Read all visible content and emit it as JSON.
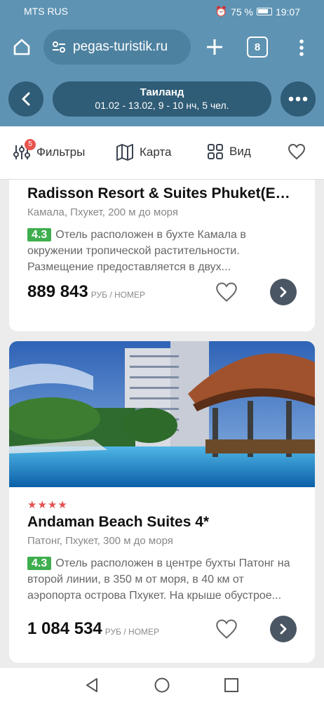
{
  "status": {
    "carrier": "MTS RUS",
    "battery": "75 %",
    "time": "19:07"
  },
  "browser": {
    "url": "pegas-turistik.ru",
    "tab_count": "8"
  },
  "search": {
    "destination": "Таиланд",
    "params": "01.02 - 13.02, 9 - 10 нч, 5 чел."
  },
  "filters": {
    "filter_label": "Фильтры",
    "filter_count": "5",
    "map_label": "Карта",
    "view_label": "Вид"
  },
  "hotels": [
    {
      "name": "Radisson Resort & Suites Phuket(Ex. S...",
      "location": "Камала, Пхукет, 200 м до моря",
      "rating": "4.3",
      "description": "Отель расположен в бухте Камала в окружении тропической растительности. Размещение предоставляется в двух...",
      "price": "889 843",
      "price_unit": "РУБ / НОМЕР"
    },
    {
      "stars": "★★★★",
      "name": "Andaman Beach Suites 4*",
      "location": "Патонг, Пхукет, 300 м до моря",
      "rating": "4.3",
      "description": "Отель расположен в центре бухты Патонг на второй линии, в 350 м от моря, в 40 км от аэропорта острова Пхукет. На крыше обустрое...",
      "price": "1 084 534",
      "price_unit": "РУБ / НОМЕР"
    }
  ],
  "colors": {
    "header_bg": "#5e93b3",
    "pill_bg": "#2f5c76",
    "rating_green": "#3fae4e",
    "star_red": "#e45050",
    "badge_red": "#e8544f"
  }
}
